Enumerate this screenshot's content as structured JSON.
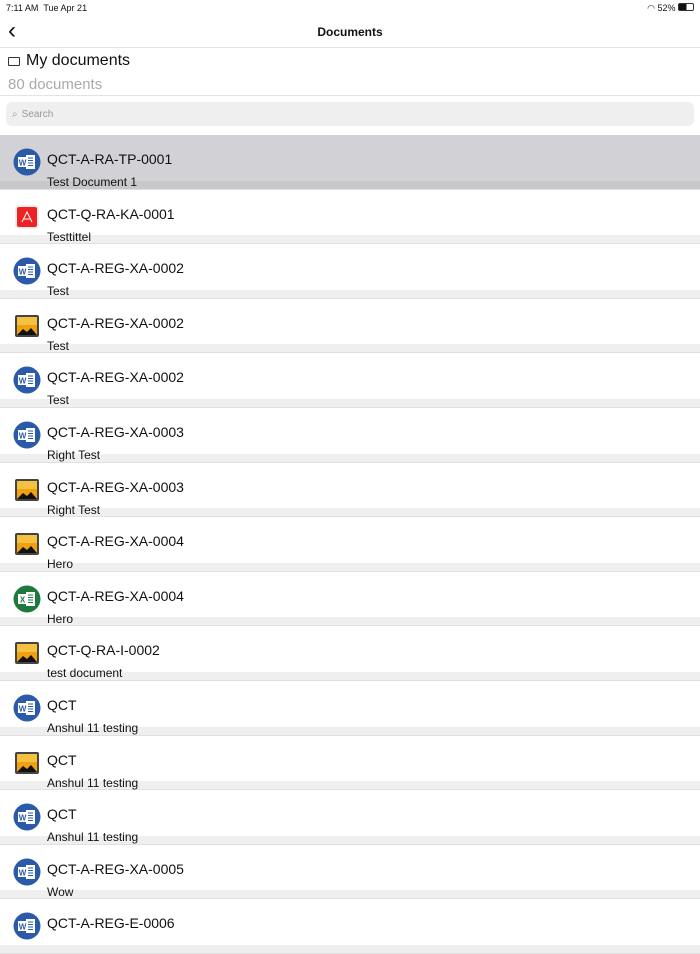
{
  "status": {
    "time": "7:11 AM",
    "date": "Tue Apr 21",
    "battery": "52%"
  },
  "nav": {
    "title": "Documents"
  },
  "folder": {
    "name": "My documents",
    "count": "80 documents"
  },
  "search": {
    "placeholder": "Search"
  },
  "documents": [
    {
      "title": "QCT-A-RA-TP-0001",
      "subtitle": "Test Document 1",
      "type": "word",
      "selected": true
    },
    {
      "title": "QCT-Q-RA-KA-0001",
      "subtitle": "Testtittel",
      "type": "pdf"
    },
    {
      "title": "QCT-A-REG-XA-0002",
      "subtitle": "Test",
      "type": "word"
    },
    {
      "title": "QCT-A-REG-XA-0002",
      "subtitle": "Test",
      "type": "image"
    },
    {
      "title": "QCT-A-REG-XA-0002",
      "subtitle": "Test",
      "type": "word"
    },
    {
      "title": "QCT-A-REG-XA-0003",
      "subtitle": "Right Test",
      "type": "word"
    },
    {
      "title": "QCT-A-REG-XA-0003",
      "subtitle": "Right Test",
      "type": "image"
    },
    {
      "title": "QCT-A-REG-XA-0004",
      "subtitle": "Hero",
      "type": "image"
    },
    {
      "title": "QCT-A-REG-XA-0004",
      "subtitle": "Hero",
      "type": "excel"
    },
    {
      "title": "QCT-Q-RA-I-0002",
      "subtitle": "test document",
      "type": "image"
    },
    {
      "title": "QCT",
      "subtitle": "Anshul 11 testing",
      "type": "word"
    },
    {
      "title": "QCT",
      "subtitle": "Anshul 11 testing",
      "type": "image"
    },
    {
      "title": "QCT",
      "subtitle": "Anshul 11 testing",
      "type": "word"
    },
    {
      "title": "QCT-A-REG-XA-0005",
      "subtitle": "Wow",
      "type": "word"
    },
    {
      "title": "QCT-A-REG-E-0006",
      "subtitle": "",
      "type": "word"
    }
  ]
}
